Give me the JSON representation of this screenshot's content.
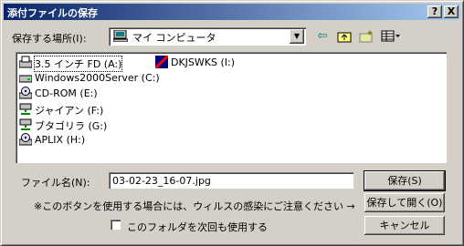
{
  "title": "添付ファイルの保存",
  "titlebar_buttons": {
    "help": "?",
    "close": "X"
  },
  "location": {
    "label": "保存する場所(I):",
    "value": "マイ コンピュータ"
  },
  "toolbar": {
    "icons": [
      "back-icon",
      "up-folder-icon",
      "new-folder-icon",
      "view-menu-icon"
    ]
  },
  "files": [
    {
      "name": "3.5 インチ FD (A:)",
      "icon": "floppy-drive-icon"
    },
    {
      "name": "Windows2000Server (C:)",
      "icon": "hard-drive-icon"
    },
    {
      "name": "CD-ROM (E:)",
      "icon": "cdrom-icon"
    },
    {
      "name": "ジャイアン (F:)",
      "icon": "network-drive-icon"
    },
    {
      "name": "ブタゴリラ (G:)",
      "icon": "network-drive-icon"
    },
    {
      "name": "APLIX (H:)",
      "icon": "cdrom-icon"
    },
    {
      "name": "DKJSWKS (I:)",
      "icon": "removable-drive-icon"
    }
  ],
  "filename": {
    "label": "ファイル名(N):",
    "value": "03-02-23_16-07.jpg"
  },
  "warning": "※このボタンを使用する場合には、ウィルスの感染にご注意ください →",
  "checkbox_label": "このフォルダを次回も使用する",
  "buttons": {
    "save": "保存(S)",
    "save_open": "保存して開く(O)",
    "cancel": "キャンセル"
  }
}
